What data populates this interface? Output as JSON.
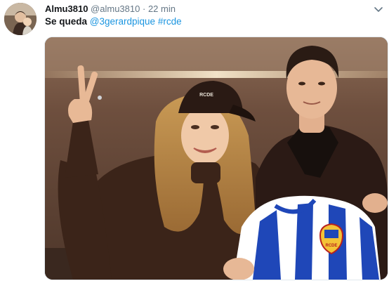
{
  "tweet": {
    "display_name": "Almu3810",
    "handle": "@almu3810",
    "separator": "·",
    "time": "22 min",
    "text_plain": "Se queda",
    "mention": "@3gerardpique",
    "hashtag": "#rcde"
  },
  "icons": {
    "menu": "chevron-down-icon",
    "avatar": "avatar"
  },
  "photo": {
    "cap_text": "RCDE",
    "crest_text": "RCDE"
  },
  "colors": {
    "link": "#1b95e0",
    "muted": "#657786",
    "text": "#14171a"
  }
}
